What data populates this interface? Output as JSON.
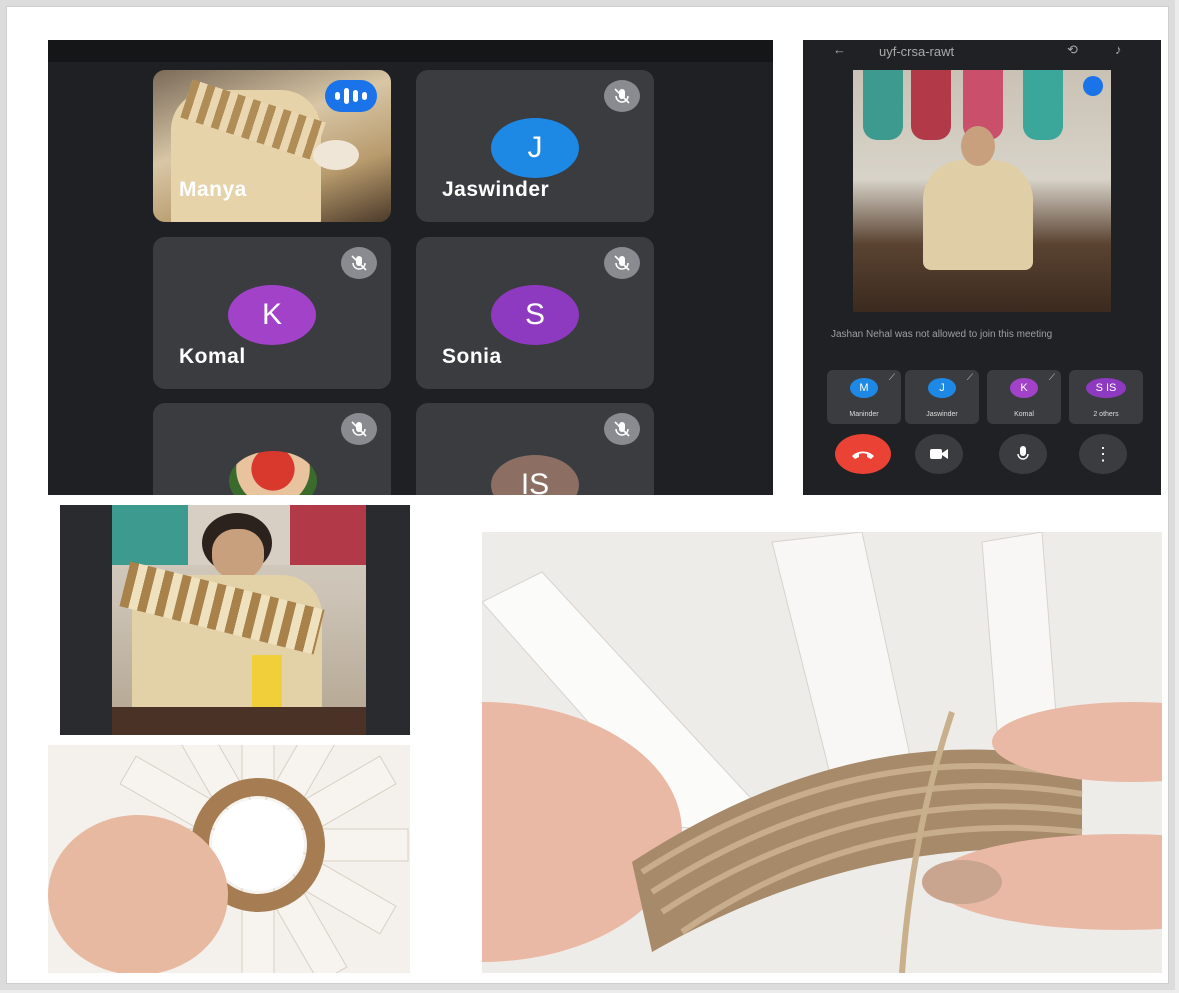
{
  "meeting_grid": {
    "participants": [
      {
        "name": "Manya",
        "status": "speaking"
      },
      {
        "name": "Jaswinder",
        "initial": "J",
        "color": "#1e88e5",
        "status": "muted"
      },
      {
        "name": "Komal",
        "initial": "K",
        "color": "#a142c9",
        "status": "muted"
      },
      {
        "name": "Sonia",
        "initial": "S",
        "color": "#8e3ac0",
        "status": "muted"
      },
      {
        "name": "",
        "status": "muted"
      },
      {
        "name": "",
        "initial": "IS",
        "color": "#8d6e63",
        "status": "muted"
      }
    ]
  },
  "meet_phone": {
    "meeting_code": "uyf-crsa-rawt",
    "notice": "Jashan Nehal was not allowed to join this meeting",
    "strip": [
      {
        "initial": "M",
        "label": "Maninder",
        "color": "#1e88e5"
      },
      {
        "initial": "J",
        "label": "Jaswinder",
        "color": "#1e88e5"
      },
      {
        "initial": "K",
        "label": "Komal",
        "color": "#a142c9"
      },
      {
        "initial": "S IS",
        "label": "2 others",
        "color": "#8e3ac0"
      }
    ],
    "controls": [
      "end-call",
      "camera",
      "microphone",
      "more"
    ]
  },
  "colors": {
    "end_call": "#ea4335",
    "speaking": "#1a73e8",
    "tile_bg": "#3b3c40",
    "panel_bg": "#202124"
  }
}
